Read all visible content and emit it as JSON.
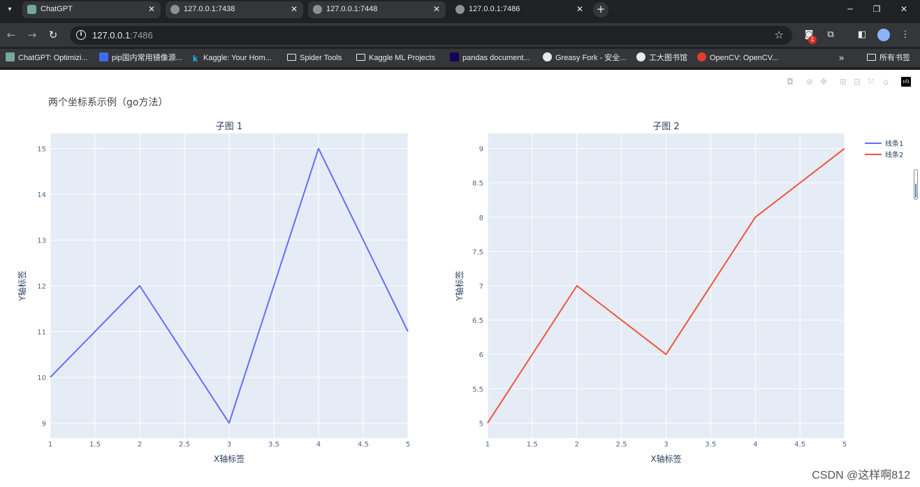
{
  "browser": {
    "tabs": [
      {
        "title": "ChatGPT",
        "icon": "chatgpt-icon"
      },
      {
        "title": "127.0.0.1:7438",
        "icon": "globe-icon"
      },
      {
        "title": "127.0.0.1:7448",
        "icon": "globe-icon"
      },
      {
        "title": "127.0.0.1:7486",
        "icon": "globe-icon"
      }
    ],
    "url_host": "127.0.0.1",
    "url_port": ":7486",
    "extension_badge": "1",
    "bookmarks": [
      {
        "label": "ChatGPT: Optimizi...",
        "icon": "chatgpt-icon"
      },
      {
        "label": "pip国内常用镜像源...",
        "icon": "zhihu-icon"
      },
      {
        "label": "Kaggle: Your Hom...",
        "icon": "kaggle-icon"
      },
      {
        "label": "Spider Tools",
        "icon": "folder-icon"
      },
      {
        "label": "Kaggle ML Projects",
        "icon": "folder-icon"
      },
      {
        "label": "pandas document...",
        "icon": "pandas-icon"
      },
      {
        "label": "Greasy Fork - 安全...",
        "icon": "greasyfork-icon"
      },
      {
        "label": "工大图书馆",
        "icon": "globe-icon"
      },
      {
        "label": "OpenCV: OpenCV...",
        "icon": "opencv-icon"
      }
    ],
    "bookmarks_more": "»",
    "all_bookmarks": "所有书签"
  },
  "page": {
    "title": "两个坐标系示例（go方法）",
    "watermark": "CSDN @这样啊812"
  },
  "chart_data": [
    {
      "type": "line",
      "title": "子图 1",
      "xlabel": "X轴标签",
      "ylabel": "Y轴标签",
      "x": [
        1,
        2,
        3,
        4,
        5
      ],
      "series": [
        {
          "name": "线条1",
          "values": [
            10,
            12,
            9,
            15,
            11
          ],
          "color": "#636efa"
        }
      ],
      "xlim": [
        1,
        5
      ],
      "ylim": [
        8.67,
        15.33
      ],
      "xticks": [
        "1",
        "1.5",
        "2",
        "2.5",
        "3",
        "3.5",
        "4",
        "4.5",
        "5"
      ],
      "yticks": [
        "9",
        "10",
        "11",
        "12",
        "13",
        "14",
        "15"
      ],
      "grid": true,
      "plot_bgcolor": "#e5ecf6"
    },
    {
      "type": "line",
      "title": "子图 2",
      "xlabel": "X轴标签",
      "ylabel": "Y轴标签",
      "x": [
        1,
        2,
        3,
        4,
        5
      ],
      "series": [
        {
          "name": "线条2",
          "values": [
            5,
            7,
            6,
            8,
            9
          ],
          "color": "#ef553b"
        }
      ],
      "xlim": [
        1,
        5
      ],
      "ylim": [
        4.78,
        9.22
      ],
      "xticks": [
        "1",
        "1.5",
        "2",
        "2.5",
        "3",
        "3.5",
        "4",
        "4.5",
        "5"
      ],
      "yticks": [
        "5",
        "5.5",
        "6",
        "6.5",
        "7",
        "7.5",
        "8",
        "8.5",
        "9"
      ],
      "grid": true,
      "plot_bgcolor": "#e5ecf6"
    }
  ],
  "legend": {
    "position": "top-right",
    "items": [
      {
        "label": "线条1",
        "color": "#636efa"
      },
      {
        "label": "线条2",
        "color": "#ef553b"
      }
    ]
  },
  "modebar": [
    "camera-icon",
    "zoom-icon",
    "pan-icon",
    "zoom-in-icon",
    "zoom-out-icon",
    "autoscale-icon",
    "reset-axes-icon",
    "plotly-logo-icon"
  ]
}
